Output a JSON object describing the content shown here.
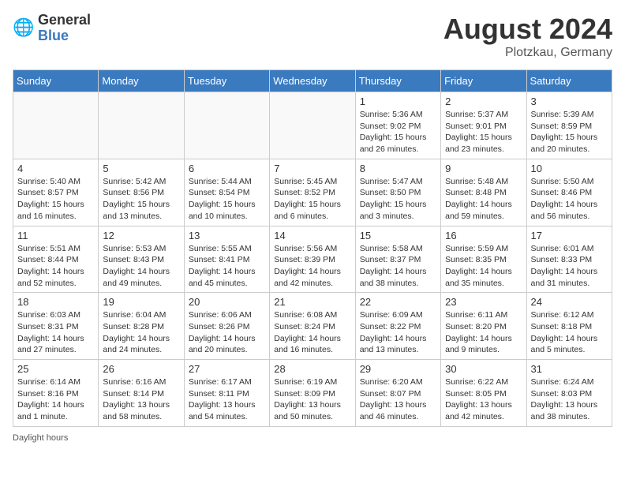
{
  "header": {
    "logo_general": "General",
    "logo_blue": "Blue",
    "month_year": "August 2024",
    "location": "Plotzkau, Germany"
  },
  "days_of_week": [
    "Sunday",
    "Monday",
    "Tuesday",
    "Wednesday",
    "Thursday",
    "Friday",
    "Saturday"
  ],
  "weeks": [
    [
      {
        "day": "",
        "info": ""
      },
      {
        "day": "",
        "info": ""
      },
      {
        "day": "",
        "info": ""
      },
      {
        "day": "",
        "info": ""
      },
      {
        "day": "1",
        "info": "Sunrise: 5:36 AM\nSunset: 9:02 PM\nDaylight: 15 hours and 26 minutes."
      },
      {
        "day": "2",
        "info": "Sunrise: 5:37 AM\nSunset: 9:01 PM\nDaylight: 15 hours and 23 minutes."
      },
      {
        "day": "3",
        "info": "Sunrise: 5:39 AM\nSunset: 8:59 PM\nDaylight: 15 hours and 20 minutes."
      }
    ],
    [
      {
        "day": "4",
        "info": "Sunrise: 5:40 AM\nSunset: 8:57 PM\nDaylight: 15 hours and 16 minutes."
      },
      {
        "day": "5",
        "info": "Sunrise: 5:42 AM\nSunset: 8:56 PM\nDaylight: 15 hours and 13 minutes."
      },
      {
        "day": "6",
        "info": "Sunrise: 5:44 AM\nSunset: 8:54 PM\nDaylight: 15 hours and 10 minutes."
      },
      {
        "day": "7",
        "info": "Sunrise: 5:45 AM\nSunset: 8:52 PM\nDaylight: 15 hours and 6 minutes."
      },
      {
        "day": "8",
        "info": "Sunrise: 5:47 AM\nSunset: 8:50 PM\nDaylight: 15 hours and 3 minutes."
      },
      {
        "day": "9",
        "info": "Sunrise: 5:48 AM\nSunset: 8:48 PM\nDaylight: 14 hours and 59 minutes."
      },
      {
        "day": "10",
        "info": "Sunrise: 5:50 AM\nSunset: 8:46 PM\nDaylight: 14 hours and 56 minutes."
      }
    ],
    [
      {
        "day": "11",
        "info": "Sunrise: 5:51 AM\nSunset: 8:44 PM\nDaylight: 14 hours and 52 minutes."
      },
      {
        "day": "12",
        "info": "Sunrise: 5:53 AM\nSunset: 8:43 PM\nDaylight: 14 hours and 49 minutes."
      },
      {
        "day": "13",
        "info": "Sunrise: 5:55 AM\nSunset: 8:41 PM\nDaylight: 14 hours and 45 minutes."
      },
      {
        "day": "14",
        "info": "Sunrise: 5:56 AM\nSunset: 8:39 PM\nDaylight: 14 hours and 42 minutes."
      },
      {
        "day": "15",
        "info": "Sunrise: 5:58 AM\nSunset: 8:37 PM\nDaylight: 14 hours and 38 minutes."
      },
      {
        "day": "16",
        "info": "Sunrise: 5:59 AM\nSunset: 8:35 PM\nDaylight: 14 hours and 35 minutes."
      },
      {
        "day": "17",
        "info": "Sunrise: 6:01 AM\nSunset: 8:33 PM\nDaylight: 14 hours and 31 minutes."
      }
    ],
    [
      {
        "day": "18",
        "info": "Sunrise: 6:03 AM\nSunset: 8:31 PM\nDaylight: 14 hours and 27 minutes."
      },
      {
        "day": "19",
        "info": "Sunrise: 6:04 AM\nSunset: 8:28 PM\nDaylight: 14 hours and 24 minutes."
      },
      {
        "day": "20",
        "info": "Sunrise: 6:06 AM\nSunset: 8:26 PM\nDaylight: 14 hours and 20 minutes."
      },
      {
        "day": "21",
        "info": "Sunrise: 6:08 AM\nSunset: 8:24 PM\nDaylight: 14 hours and 16 minutes."
      },
      {
        "day": "22",
        "info": "Sunrise: 6:09 AM\nSunset: 8:22 PM\nDaylight: 14 hours and 13 minutes."
      },
      {
        "day": "23",
        "info": "Sunrise: 6:11 AM\nSunset: 8:20 PM\nDaylight: 14 hours and 9 minutes."
      },
      {
        "day": "24",
        "info": "Sunrise: 6:12 AM\nSunset: 8:18 PM\nDaylight: 14 hours and 5 minutes."
      }
    ],
    [
      {
        "day": "25",
        "info": "Sunrise: 6:14 AM\nSunset: 8:16 PM\nDaylight: 14 hours and 1 minute."
      },
      {
        "day": "26",
        "info": "Sunrise: 6:16 AM\nSunset: 8:14 PM\nDaylight: 13 hours and 58 minutes."
      },
      {
        "day": "27",
        "info": "Sunrise: 6:17 AM\nSunset: 8:11 PM\nDaylight: 13 hours and 54 minutes."
      },
      {
        "day": "28",
        "info": "Sunrise: 6:19 AM\nSunset: 8:09 PM\nDaylight: 13 hours and 50 minutes."
      },
      {
        "day": "29",
        "info": "Sunrise: 6:20 AM\nSunset: 8:07 PM\nDaylight: 13 hours and 46 minutes."
      },
      {
        "day": "30",
        "info": "Sunrise: 6:22 AM\nSunset: 8:05 PM\nDaylight: 13 hours and 42 minutes."
      },
      {
        "day": "31",
        "info": "Sunrise: 6:24 AM\nSunset: 8:03 PM\nDaylight: 13 hours and 38 minutes."
      }
    ]
  ],
  "footer": "Daylight hours"
}
